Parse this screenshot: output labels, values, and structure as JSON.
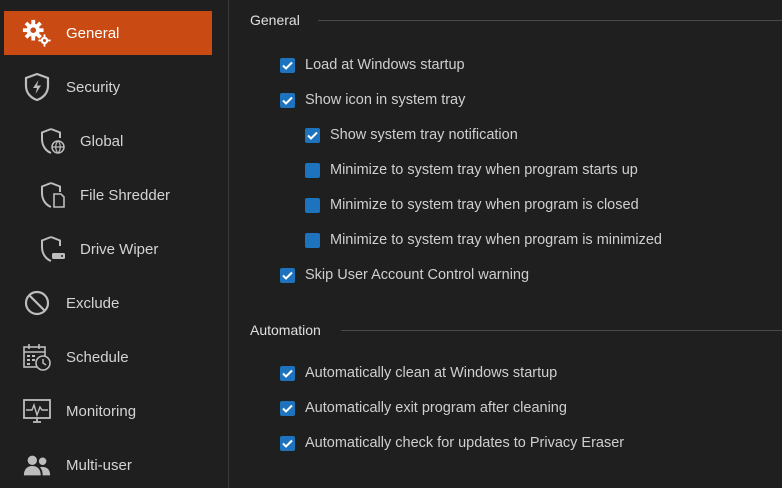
{
  "sidebar": {
    "items": [
      {
        "label": "General",
        "icon": "gears-icon",
        "active": true
      },
      {
        "label": "Security",
        "icon": "shield-lightning-icon"
      },
      {
        "label": "Global",
        "icon": "shield-globe-icon"
      },
      {
        "label": "File Shredder",
        "icon": "shield-file-icon"
      },
      {
        "label": "Drive Wiper",
        "icon": "shield-drive-icon"
      },
      {
        "label": "Exclude",
        "icon": "prohibited-icon"
      },
      {
        "label": "Schedule",
        "icon": "calendar-clock-icon"
      },
      {
        "label": "Monitoring",
        "icon": "monitor-pulse-icon"
      },
      {
        "label": "Multi-user",
        "icon": "users-icon"
      }
    ]
  },
  "general": {
    "title": "General",
    "options": [
      {
        "label": "Load at Windows startup",
        "checked": true
      },
      {
        "label": "Show icon in system tray",
        "checked": true
      },
      {
        "label": "Show system tray notification",
        "checked": true
      },
      {
        "label": "Minimize to system tray when program starts up",
        "checked": false
      },
      {
        "label": "Minimize to system tray when program is closed",
        "checked": false
      },
      {
        "label": "Minimize to system tray when program is minimized",
        "checked": false
      },
      {
        "label": "Skip User Account Control warning",
        "checked": true
      }
    ]
  },
  "automation": {
    "title": "Automation",
    "options": [
      {
        "label": "Automatically clean at Windows startup",
        "checked": true
      },
      {
        "label": "Automatically exit program after cleaning",
        "checked": true
      },
      {
        "label": "Automatically check for updates to Privacy Eraser",
        "checked": true
      }
    ]
  },
  "colors": {
    "accent": "#c94a12",
    "checkbox": "#1e73be",
    "background": "#1f1f1f"
  }
}
